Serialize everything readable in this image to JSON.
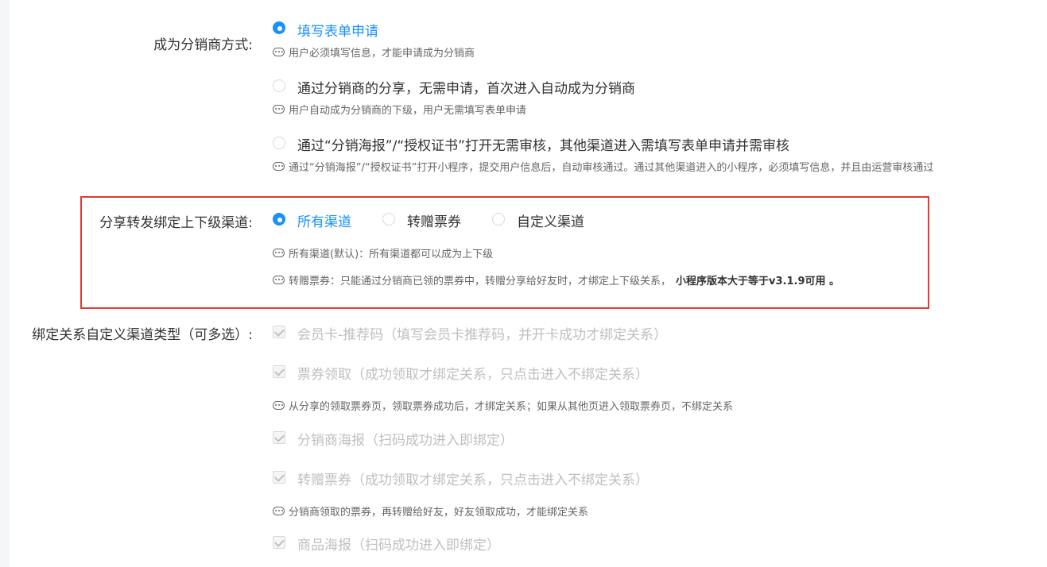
{
  "method": {
    "label": "成为分销商方式:",
    "options": [
      {
        "text": "填写表单申请",
        "hint": "用户必须填写信息，才能申请成为分销商",
        "checked": true
      },
      {
        "text": "通过分销商的分享，无需申请，首次进入自动成为分销商",
        "hint": "用户自动成为分销商的下级，用户无需填写表单申请",
        "checked": false
      },
      {
        "text": "通过“分销海报”/“授权证书”打开无需审核，其他渠道进入需填写表单申请并需审核",
        "hint": "通过“分销海报”/“授权证书”打开小程序，提交用户信息后，自动审核通过。通过其他渠道进入的小程序，必须填写信息，并且由运营审核通过",
        "checked": false
      }
    ]
  },
  "channel": {
    "label": "分享转发绑定上下级渠道:",
    "options": [
      {
        "text": "所有渠道",
        "checked": true
      },
      {
        "text": "转赠票券",
        "checked": false
      },
      {
        "text": "自定义渠道",
        "checked": false
      }
    ],
    "hint1": "所有渠道(默认)：所有渠道都可以成为上下级",
    "hint2": "转赠票券：只能通过分销商已领的票券中，转赠分享给好友时，才绑定上下级关系，",
    "hint2_bold": "小程序版本大于等于v3.1.9可用 。"
  },
  "custom": {
    "label": "绑定关系自定义渠道类型（可多选）:",
    "items": [
      {
        "text": "会员卡-推荐码（填写会员卡推荐码，并开卡成功才绑定关系）",
        "hint": ""
      },
      {
        "text": "票券领取（成功领取才绑定关系，只点击进入不绑定关系）",
        "hint": "从分享的领取票券页，领取票券成功后，才绑定关系；如果从其他页进入领取票券页，不绑定关系"
      },
      {
        "text": "分销商海报（扫码成功进入即绑定）",
        "hint": ""
      },
      {
        "text": "转赠票券（成功领取才绑定关系，只点击进入不绑定关系）",
        "hint": "分销商领取的票券，再转赠给好友，好友领取成功，才能绑定关系"
      },
      {
        "text": "商品海报（扫码成功进入即绑定）",
        "hint": ""
      }
    ]
  },
  "colors": {
    "primary": "#1890ff",
    "highlight_border": "#e53935",
    "disabled_text": "#bfbfbf"
  }
}
